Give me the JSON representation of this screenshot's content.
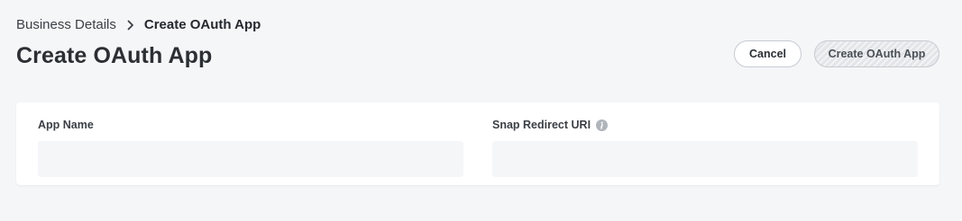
{
  "breadcrumb": {
    "parent": "Business Details",
    "current": "Create OAuth App"
  },
  "page": {
    "title": "Create OAuth App"
  },
  "actions": {
    "cancel_label": "Cancel",
    "create_label": "Create OAuth App",
    "create_disabled": true
  },
  "form": {
    "app_name": {
      "label": "App Name",
      "value": "",
      "placeholder": ""
    },
    "redirect_uri": {
      "label": "Snap Redirect URI",
      "value": "",
      "placeholder": "",
      "help_icon": "info-icon"
    }
  },
  "colors": {
    "page_background": "#f5f6f8",
    "card_background": "#ffffff",
    "input_background": "#f5f6f8",
    "text_primary": "#2b2f33",
    "border": "#c6cbd1",
    "disabled_button": "#e3e5e8",
    "info_icon": "#b0b5bb"
  }
}
